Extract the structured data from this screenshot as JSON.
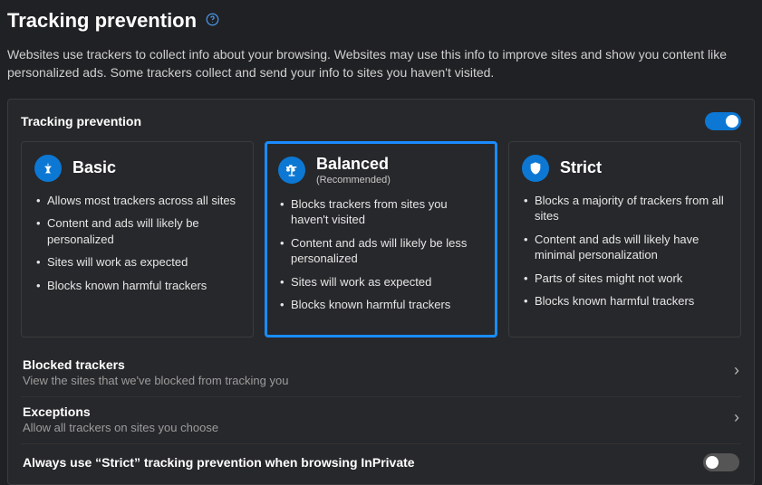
{
  "header": {
    "title": "Tracking prevention",
    "description": "Websites use trackers to collect info about your browsing. Websites may use this info to improve sites and show you content like personalized ads. Some trackers collect and send your info to sites you haven't visited."
  },
  "panel": {
    "title": "Tracking prevention",
    "enabled": true,
    "selected": "balanced",
    "levels": {
      "basic": {
        "title": "Basic",
        "subtitle": "",
        "bullets": [
          "Allows most trackers across all sites",
          "Content and ads will likely be personalized",
          "Sites will work as expected",
          "Blocks known harmful trackers"
        ]
      },
      "balanced": {
        "title": "Balanced",
        "subtitle": "(Recommended)",
        "bullets": [
          "Blocks trackers from sites you haven't visited",
          "Content and ads will likely be less personalized",
          "Sites will work as expected",
          "Blocks known harmful trackers"
        ]
      },
      "strict": {
        "title": "Strict",
        "subtitle": "",
        "bullets": [
          "Blocks a majority of trackers from all sites",
          "Content and ads will likely have minimal personalization",
          "Parts of sites might not work",
          "Blocks known harmful trackers"
        ]
      }
    },
    "blocked": {
      "title": "Blocked trackers",
      "desc": "View the sites that we've blocked from tracking you"
    },
    "exceptions": {
      "title": "Exceptions",
      "desc": "Allow all trackers on sites you choose"
    },
    "strictInPrivate": {
      "title": "Always use “Strict” tracking prevention when browsing InPrivate",
      "enabled": false
    }
  }
}
